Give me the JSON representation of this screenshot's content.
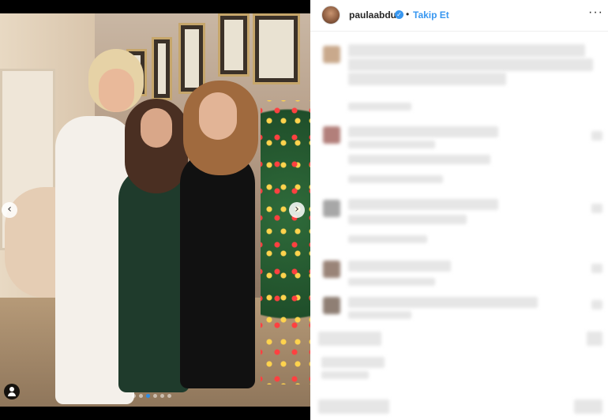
{
  "post": {
    "author": "paulaabdul",
    "verified_icon": "verified-badge-icon",
    "separator": "•",
    "follow_label": "Takip Et",
    "more_glyph": "···",
    "carousel": {
      "prev_glyph": "‹",
      "next_glyph": "›",
      "slide_count": 6,
      "active_slide": 3
    }
  },
  "colors": {
    "link": "#3897f0",
    "text": "#262626",
    "divider": "#efefef"
  },
  "comments_note": "pixelated"
}
